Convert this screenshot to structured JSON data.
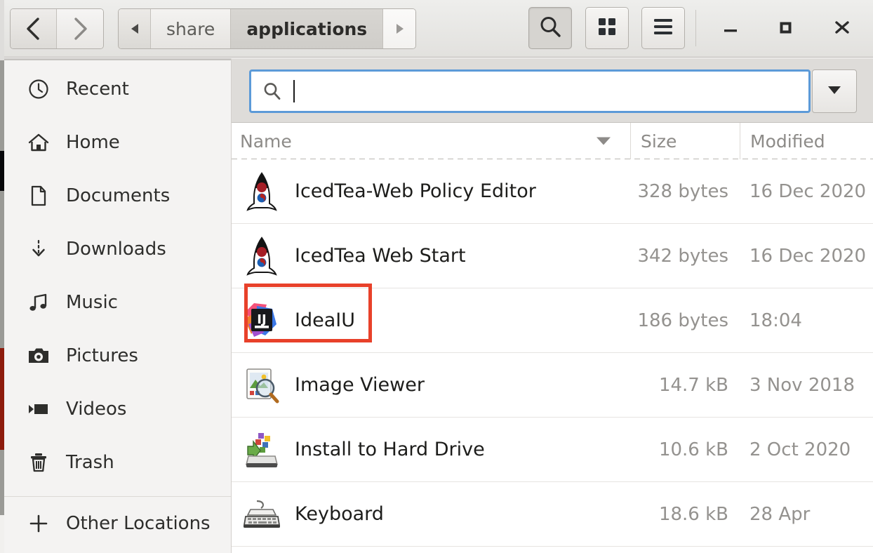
{
  "window": {
    "title": "applications",
    "controls": {
      "minimize": "minimize-label",
      "maximize": "maximize-label",
      "close": "close-label"
    }
  },
  "header": {
    "nav": {
      "back_label": "Back",
      "forward_label": "Forward"
    },
    "breadcrumb": {
      "scroll_left_label": "◀",
      "scroll_right_label": "▶",
      "items": [
        {
          "label": "share",
          "current": false
        },
        {
          "label": "applications",
          "current": true
        }
      ]
    },
    "buttons": {
      "search_label": "Search",
      "view_grid_label": "Grid View",
      "menu_label": "Main Menu"
    }
  },
  "sidebar": {
    "items": [
      {
        "label": "Recent",
        "icon": "clock-icon"
      },
      {
        "label": "Home",
        "icon": "home-icon"
      },
      {
        "label": "Documents",
        "icon": "document-icon"
      },
      {
        "label": "Downloads",
        "icon": "download-icon"
      },
      {
        "label": "Music",
        "icon": "music-note-icon"
      },
      {
        "label": "Pictures",
        "icon": "camera-icon"
      },
      {
        "label": "Videos",
        "icon": "video-icon"
      },
      {
        "label": "Trash",
        "icon": "trash-icon"
      }
    ],
    "other_locations": {
      "label": "Other Locations",
      "icon": "plus-icon"
    }
  },
  "search": {
    "value": "",
    "placeholder": "",
    "icon": "search-icon",
    "dropdown_label": "▼"
  },
  "columns": {
    "name": "Name",
    "size": "Size",
    "modified": "Modified",
    "sort_column": "Name",
    "sort_direction": "descending"
  },
  "files": [
    {
      "name": "IcedTea-Web Policy Editor",
      "size": "328 bytes",
      "modified": "16 Dec 2020",
      "icon": "icedtea-rocket-icon",
      "highlighted": false
    },
    {
      "name": "IcedTea Web Start",
      "size": "342 bytes",
      "modified": "16 Dec 2020",
      "icon": "icedtea-rocket-icon",
      "highlighted": false
    },
    {
      "name": "IdeaIU",
      "size": "186 bytes",
      "modified": "18:04",
      "icon": "intellij-idea-icon",
      "highlighted": true
    },
    {
      "name": "Image Viewer",
      "size": "14.7 kB",
      "modified": "3 Nov 2018",
      "icon": "image-viewer-icon",
      "highlighted": false
    },
    {
      "name": "Install to Hard Drive",
      "size": "10.6 kB",
      "modified": "2 Oct 2020",
      "icon": "install-harddrive-icon",
      "highlighted": false
    },
    {
      "name": "Keyboard",
      "size": "18.6 kB",
      "modified": "28 Apr",
      "icon": "keyboard-icon",
      "highlighted": false
    }
  ],
  "colors": {
    "annotation": "#e8412a",
    "focus_border": "#5c9ad8",
    "headerbar": "#e8e6e3",
    "sidebar_bg": "#f4f3f2",
    "muted_text": "#94928f"
  }
}
